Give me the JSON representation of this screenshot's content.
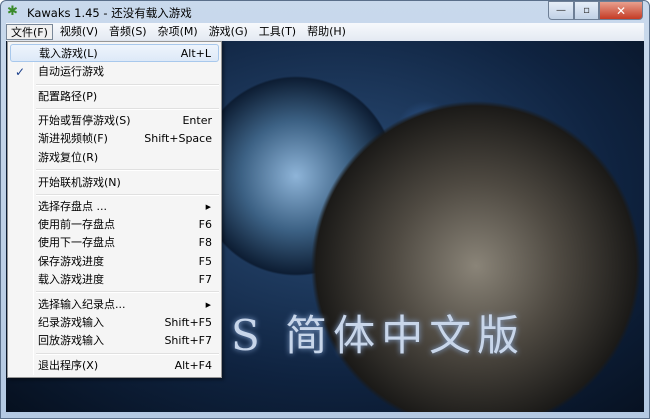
{
  "window": {
    "title": "Kawaks 1.45 - 还没有载入游戏",
    "minimize": "—",
    "maximize": "▫",
    "close": "✕"
  },
  "menubar": [
    "文件(F)",
    "视频(V)",
    "音频(S)",
    "杂项(M)",
    "游戏(G)",
    "工具(T)",
    "帮助(H)"
  ],
  "file_menu": [
    {
      "label": "载入游戏(L)",
      "shortcut": "Alt+L"
    },
    {
      "label": "自动运行游戏",
      "shortcut": "",
      "checked": "✓"
    },
    {
      "label": "配置路径(P)",
      "shortcut": ""
    },
    {
      "label": "开始或暂停游戏(S)",
      "shortcut": "Enter"
    },
    {
      "label": "渐进视频帧(F)",
      "shortcut": "Shift+Space"
    },
    {
      "label": "游戏复位(R)",
      "shortcut": ""
    },
    {
      "label": "开始联机游戏(N)",
      "shortcut": ""
    },
    {
      "label": "选择存盘点 ...",
      "shortcut": "",
      "submenu": "▶"
    },
    {
      "label": "使用前一存盘点",
      "shortcut": "F6"
    },
    {
      "label": "使用下一存盘点",
      "shortcut": "F8"
    },
    {
      "label": "保存游戏进度",
      "shortcut": "F5"
    },
    {
      "label": "载入游戏进度",
      "shortcut": "F7"
    },
    {
      "label": "选择输入纪录点...",
      "shortcut": "",
      "submenu": "▶"
    },
    {
      "label": "纪录游戏输入",
      "shortcut": "Shift+F5"
    },
    {
      "label": "回放游戏输入",
      "shortcut": "Shift+F7"
    },
    {
      "label": "退出程序(X)",
      "shortcut": "Alt+F4"
    }
  ],
  "banner": "S 简体中文版"
}
